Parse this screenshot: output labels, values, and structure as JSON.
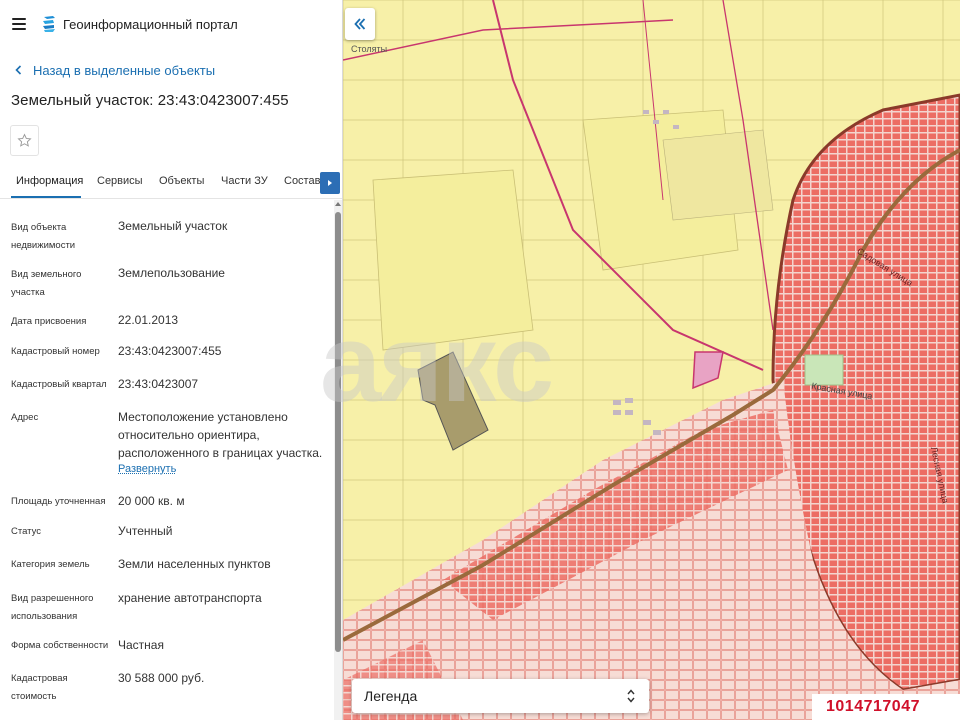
{
  "app": {
    "title": "Геоинформационный портал"
  },
  "navigation": {
    "back_label": "Назад в выделенные объекты"
  },
  "object": {
    "title": "Земельный участок: 23:43:0423007:455"
  },
  "tabs": [
    {
      "label": "Информация",
      "active": true
    },
    {
      "label": "Сервисы",
      "active": false
    },
    {
      "label": "Объекты",
      "active": false
    },
    {
      "label": "Части ЗУ",
      "active": false
    },
    {
      "label": "Состав",
      "active": false
    }
  ],
  "properties": [
    {
      "label": "Вид объекта недвижимости",
      "value": "Земельный участок"
    },
    {
      "label": "Вид земельного участка",
      "value": "Землепользование"
    },
    {
      "label": "Дата присвоения",
      "value": "22.01.2013"
    },
    {
      "label": "Кадастровый номер",
      "value": "23:43:0423007:455"
    },
    {
      "label": "Кадастровый квартал",
      "value": "23:43:0423007"
    },
    {
      "label": "Адрес",
      "value": "Местоположение установлено относительно ориентира, расположенного в границах участка."
    },
    {
      "label": "Площадь уточненная",
      "value": "20 000 кв. м"
    },
    {
      "label": "Статус",
      "value": "Учтенный"
    },
    {
      "label": "Категория земель",
      "value": "Земли населенных пунктов"
    },
    {
      "label": "Вид разрешенного использования",
      "value": "хранение автотранспорта"
    },
    {
      "label": "Форма собственности",
      "value": "Частная"
    },
    {
      "label": "Кадастровая стоимость",
      "value": "30 588 000 руб."
    }
  ],
  "address_expand_label": "Развернуть",
  "map": {
    "legend_label": "Легенда",
    "labels": {
      "settlement": "Столяты",
      "street_1": "Садовая улица",
      "street_2": "Красная улица",
      "street_3": "Лесная улица"
    },
    "watermark": "аякс",
    "listing_id": "1014717047",
    "colors": {
      "agricultural": "#f7f0a8",
      "urban": "#f3c6bd",
      "dense_urban": "#ea5f57",
      "boundary": "#c8366e",
      "selected_parcel": "#a89c6c",
      "road": "#9a6a3c"
    }
  },
  "colors": {
    "accent": "#1b6fb1",
    "tab_scroll": "#2c6eb5"
  }
}
